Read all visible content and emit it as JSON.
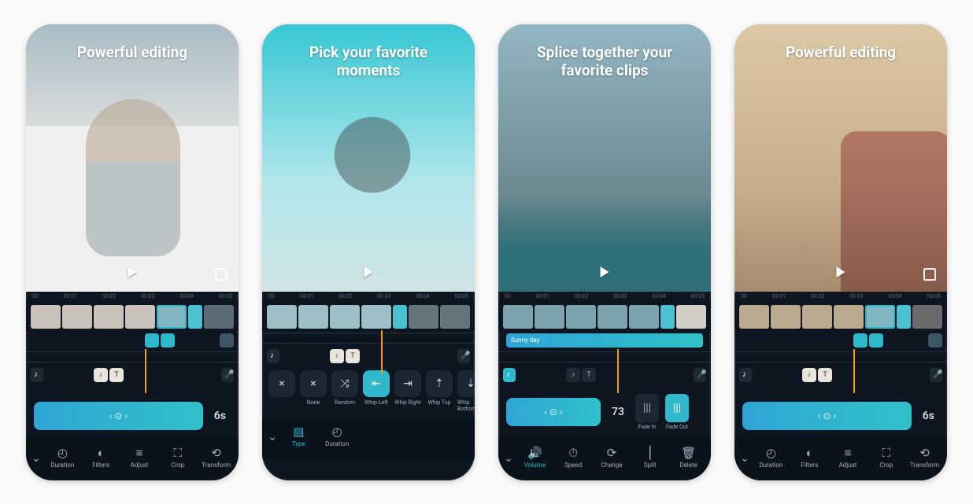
{
  "common": {
    "timecodes": [
      "00",
      "00:01",
      "00:02",
      "00:03",
      "00:04",
      "00:05"
    ]
  },
  "screens": [
    {
      "headline": "Powerful editing",
      "slider_value": "6s",
      "thumbs": [
        "t",
        "t",
        "t",
        "t",
        "sel",
        "trans",
        "t"
      ],
      "clip_pair": true,
      "toolbar": [
        {
          "icon": "clock",
          "label": "Duration"
        },
        {
          "icon": "palette",
          "label": "Filters"
        },
        {
          "icon": "sliders",
          "label": "Adjust"
        },
        {
          "icon": "crop",
          "label": "Crop"
        },
        {
          "icon": "transform",
          "label": "Transform"
        }
      ]
    },
    {
      "headline": "Pick your favorite moments",
      "thumbs": [
        "t",
        "t",
        "t",
        "t",
        "trans",
        "t",
        "t"
      ],
      "trans_btn_close": "×",
      "transitions": [
        {
          "icon": "×",
          "label": "None"
        },
        {
          "icon": "⤨",
          "label": "Random"
        },
        {
          "icon": "⇤",
          "label": "Whip Left",
          "selected": true
        },
        {
          "icon": "⇥",
          "label": "Whip Right"
        },
        {
          "icon": "⇡",
          "label": "Whip Top"
        },
        {
          "icon": "⇣",
          "label": "Whip Bottom"
        }
      ],
      "toolbar": [
        {
          "icon": "layers",
          "label": "Type",
          "active": true
        },
        {
          "icon": "clock",
          "label": "Duration"
        }
      ]
    },
    {
      "headline": "Splice together your favorite clips",
      "clip_label": "Sunny day",
      "vol_value": "73",
      "fade_in": "Fade In",
      "fade_out": "Fade Out",
      "toolbar": [
        {
          "icon": "vol",
          "label": "Volume",
          "active": true
        },
        {
          "icon": "speed",
          "label": "Speed"
        },
        {
          "icon": "refresh",
          "label": "Change"
        },
        {
          "icon": "split",
          "label": "Split"
        },
        {
          "icon": "trash",
          "label": "Delete"
        }
      ]
    },
    {
      "headline": "Powerful editing",
      "slider_value": "6s",
      "thumbs": [
        "t",
        "t",
        "t",
        "t",
        "sel",
        "trans",
        "t"
      ],
      "clip_pair": true,
      "toolbar": [
        {
          "icon": "clock",
          "label": "Duration"
        },
        {
          "icon": "palette",
          "label": "Filters"
        },
        {
          "icon": "sliders",
          "label": "Adjust"
        },
        {
          "icon": "crop",
          "label": "Crop"
        },
        {
          "icon": "transform",
          "label": "Transform"
        }
      ]
    }
  ],
  "icon_glyphs": {
    "clock": "◴",
    "palette": "◐",
    "sliders": "≡",
    "crop": "⛶",
    "transform": "⟲",
    "layers": "▤",
    "vol": "🔊",
    "speed": "⏱",
    "refresh": "⟳",
    "split": "⎮",
    "trash": "🗑",
    "music": "♪",
    "text": "T",
    "mic": "🎤",
    "play": "▶",
    "fs": "⛶"
  }
}
